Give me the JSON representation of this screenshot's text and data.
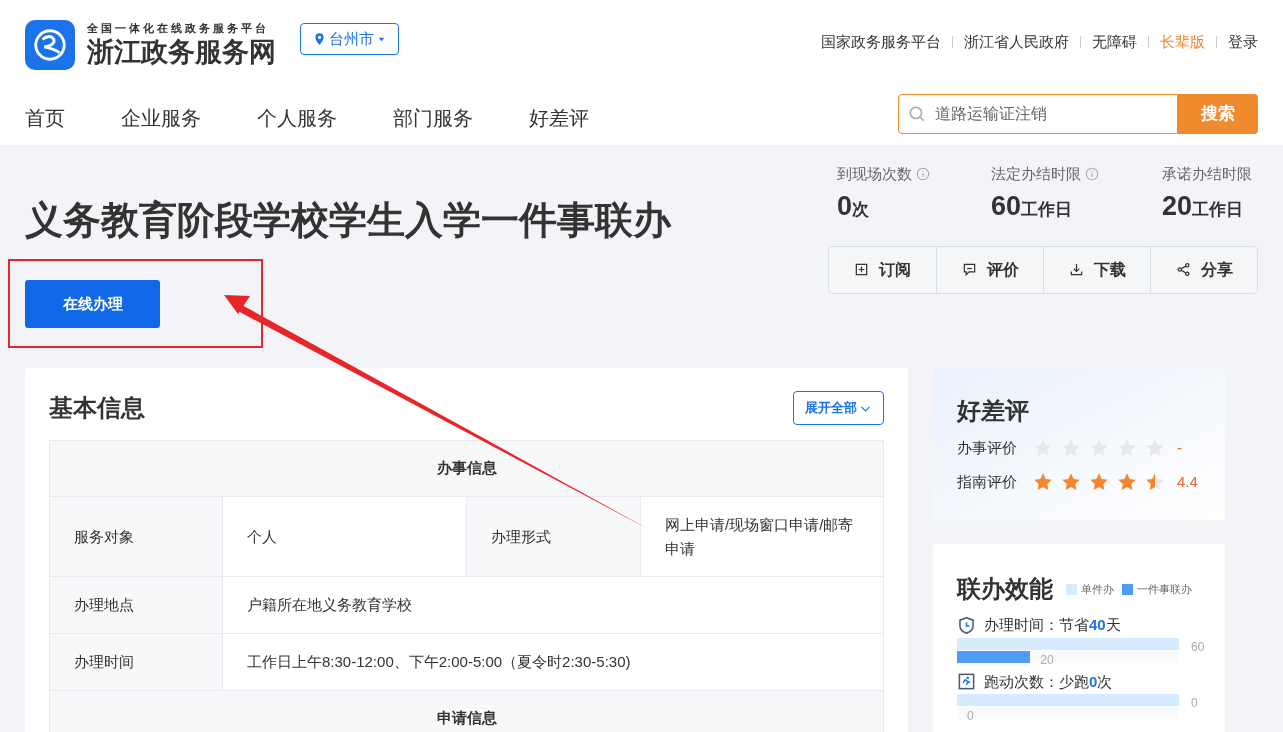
{
  "header": {
    "platform_tagline": "全国一体化在线政务服务平台",
    "site_name": "浙江政务服务网",
    "city": "台州市",
    "top_links": [
      {
        "label": "国家政务服务平台",
        "highlighted": false
      },
      {
        "label": "浙江省人民政府",
        "highlighted": false
      },
      {
        "label": "无障碍",
        "highlighted": false
      },
      {
        "label": "长辈版",
        "highlighted": true
      },
      {
        "label": "登录",
        "highlighted": false
      }
    ],
    "nav": [
      "首页",
      "企业服务",
      "个人服务",
      "部门服务",
      "好差评"
    ],
    "search": {
      "placeholder": "道路运输证注销",
      "button": "搜索"
    }
  },
  "service": {
    "title": "义务教育阶段学校学生入学一件事联办",
    "apply_button": "在线办理",
    "stats": [
      {
        "label": "到现场次数",
        "info": true,
        "value": "0",
        "unit": "次"
      },
      {
        "label": "法定办结时限",
        "info": true,
        "value": "60",
        "unit": "工作日"
      },
      {
        "label": "承诺办结时限",
        "info": false,
        "value": "20",
        "unit": "工作日"
      }
    ],
    "actions": [
      {
        "kind": "subscribe",
        "label": "订阅"
      },
      {
        "kind": "comment",
        "label": "评价"
      },
      {
        "kind": "download",
        "label": "下载"
      },
      {
        "kind": "share",
        "label": "分享"
      }
    ]
  },
  "basic_info": {
    "title": "基本信息",
    "expand_button": "展开全部",
    "rows": [
      {
        "kind": "section",
        "text": "办事信息"
      },
      {
        "kind": "pair",
        "cells": [
          "服务对象",
          "个人",
          "办理形式",
          "网上申请/现场窗口申请/邮寄申请"
        ]
      },
      {
        "kind": "wide",
        "cells": [
          "办理地点",
          "户籍所在地义务教育学校"
        ]
      },
      {
        "kind": "wide",
        "cells": [
          "办理时间",
          "工作日上午8:30-12:00、下午2:00-5:00（夏令时2:30-5:30)"
        ]
      },
      {
        "kind": "section",
        "text": "申请信息"
      }
    ]
  },
  "rating": {
    "title": "好差评",
    "items": [
      {
        "label": "办事评价",
        "stars": 0,
        "reading": "-"
      },
      {
        "label": "指南评价",
        "stars": 4.5,
        "reading": "4.4"
      }
    ]
  },
  "efficiency": {
    "title": "联办效能",
    "legend": [
      {
        "label": "单件办",
        "color": "#d6ebfd"
      },
      {
        "label": "一件事联办",
        "color": "#4d9cf8"
      }
    ],
    "metrics": [
      {
        "kind": "time",
        "prefix": "办理时间：节省",
        "highlight": "40",
        "suffix": "天",
        "single": {
          "reading": "60"
        },
        "joint": {
          "level": 0.33,
          "reading": "20"
        }
      },
      {
        "kind": "run",
        "prefix": "跑动次数：少跑",
        "highlight": "0",
        "suffix": "次",
        "single": {
          "reading": "0"
        },
        "joint": {
          "level": 0,
          "reading": "0"
        }
      }
    ]
  },
  "annotation": {
    "highlight_box": true,
    "arrow": true
  }
}
